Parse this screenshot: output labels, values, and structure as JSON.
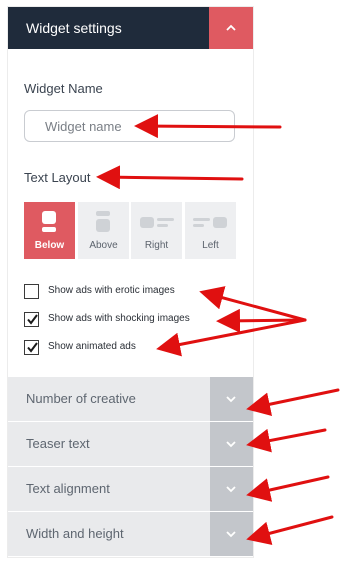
{
  "header": {
    "title": "Widget settings",
    "toggle_icon": "chevron-up-icon"
  },
  "widget_name": {
    "label": "Widget Name",
    "placeholder": "Widget name",
    "value": ""
  },
  "text_layout": {
    "label": "Text Layout",
    "options": [
      {
        "label": "Below",
        "selected": true
      },
      {
        "label": "Above",
        "selected": false
      },
      {
        "label": "Right",
        "selected": false
      },
      {
        "label": "Left",
        "selected": false
      }
    ]
  },
  "ad_options": [
    {
      "label": "Show ads with erotic images",
      "checked": false
    },
    {
      "label": "Show ads with shocking images",
      "checked": true
    },
    {
      "label": "Show animated ads",
      "checked": true
    }
  ],
  "sections": [
    {
      "label": "Number of creative",
      "icon": "chevron-down-icon"
    },
    {
      "label": "Teaser text",
      "icon": "chevron-down-icon"
    },
    {
      "label": "Text alignment",
      "icon": "chevron-down-icon"
    },
    {
      "label": "Width and height",
      "icon": "chevron-down-icon"
    }
  ],
  "colors": {
    "header_bg": "#1f2b3b",
    "accent": "#df5a61",
    "annotation_arrow": "#e01010"
  }
}
